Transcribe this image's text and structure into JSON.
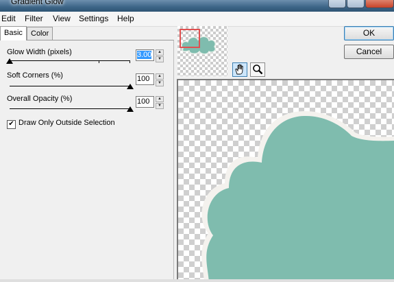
{
  "window": {
    "title": "Gradient Glow"
  },
  "menu": [
    "Edit",
    "Filter",
    "View",
    "Settings",
    "Help"
  ],
  "tabs": [
    {
      "label": "Basic",
      "active": true
    },
    {
      "label": "Color",
      "active": false
    }
  ],
  "controls": {
    "glow_width": {
      "label": "Glow Width (pixels)",
      "value": "3.00",
      "slider_fraction": 0.0
    },
    "soft_corners": {
      "label": "Soft Corners (%)",
      "value": "100",
      "slider_fraction": 1.0
    },
    "overall_opacity": {
      "label": "Overall Opacity (%)",
      "value": "100",
      "slider_fraction": 1.0
    }
  },
  "checkbox": {
    "label": "Draw Only Outside Selection",
    "checked": true
  },
  "buttons": {
    "ok": "OK",
    "cancel": "Cancel"
  },
  "tools": [
    {
      "icon": "hand-icon",
      "active": true
    },
    {
      "icon": "zoom-icon",
      "active": false
    }
  ],
  "colors": {
    "shape_fill": "#7fbcae",
    "shape_glow": "#f4f2ee",
    "thumbnail_frame": "#e05050"
  }
}
